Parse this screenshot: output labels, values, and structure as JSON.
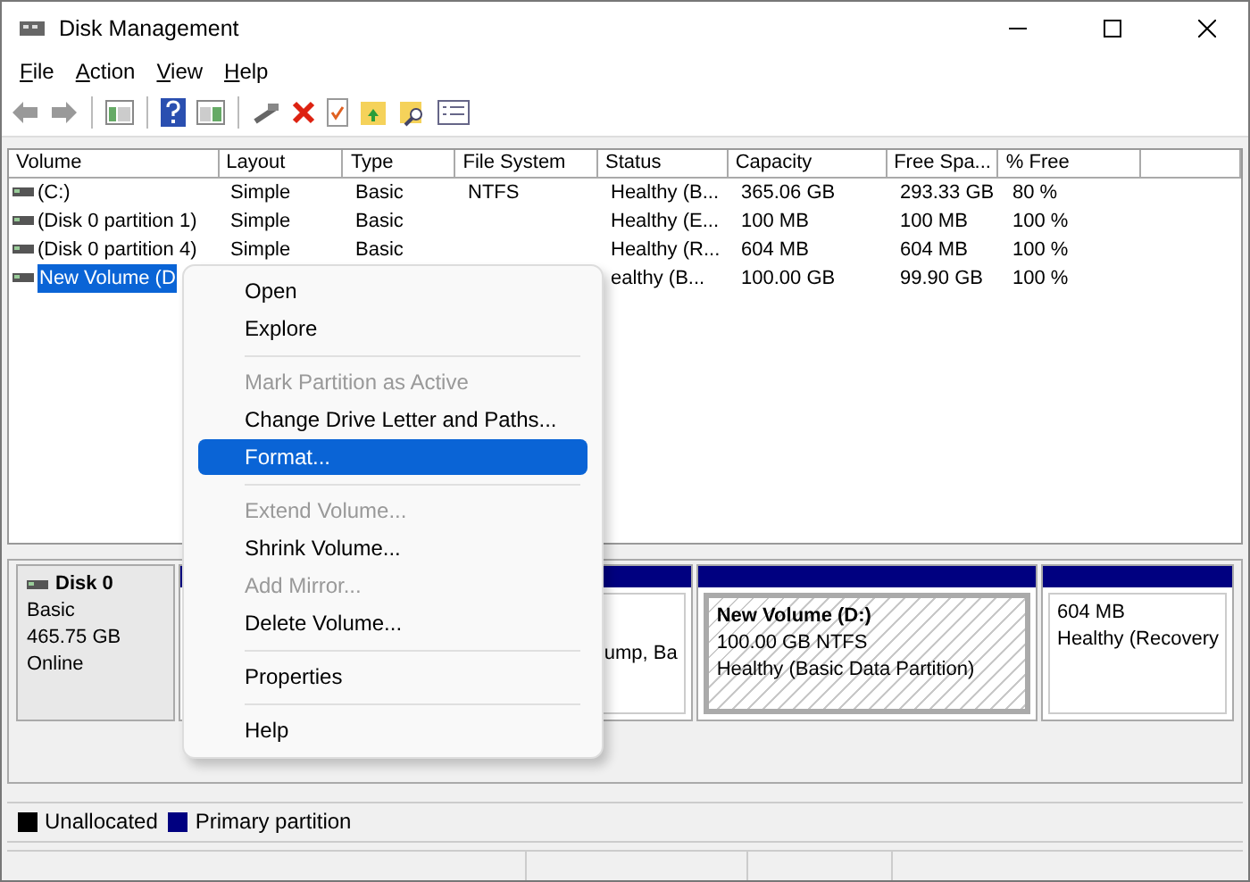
{
  "window": {
    "title": "Disk Management"
  },
  "menu_bar": [
    "File",
    "Action",
    "View",
    "Help"
  ],
  "table": {
    "columns": [
      "Volume",
      "Layout",
      "Type",
      "File System",
      "Status",
      "Capacity",
      "Free Spa...",
      "% Free"
    ],
    "rows": [
      {
        "selected": false,
        "cells": [
          "(C:)",
          "Simple",
          "Basic",
          "NTFS",
          "Healthy (B...",
          "365.06 GB",
          "293.33 GB",
          "80 %"
        ]
      },
      {
        "selected": false,
        "cells": [
          "(Disk 0 partition 1)",
          "Simple",
          "Basic",
          "",
          "Healthy (E...",
          "100 MB",
          "100 MB",
          "100 %"
        ]
      },
      {
        "selected": false,
        "cells": [
          "(Disk 0 partition 4)",
          "Simple",
          "Basic",
          "",
          "Healthy (R...",
          "604 MB",
          "604 MB",
          "100 %"
        ]
      },
      {
        "selected": true,
        "cells": [
          "New Volume (D",
          "",
          "",
          "",
          "ealthy (B...",
          "100.00 GB",
          "99.90 GB",
          "100 %"
        ]
      }
    ]
  },
  "disk": {
    "name": "Disk 0",
    "type": "Basic",
    "size": "465.75 GB",
    "state": "Online",
    "partitions": [
      {
        "lines": [
          "ump, Ba"
        ],
        "selected": false
      },
      {
        "title": "New Volume  (D:)",
        "lines": [
          "100.00 GB NTFS",
          "Healthy (Basic Data Partition)"
        ],
        "selected": true
      },
      {
        "lines": [
          "604 MB",
          "Healthy (Recovery"
        ],
        "selected": false
      }
    ]
  },
  "legend": [
    {
      "label": "Unallocated",
      "color": "#000000"
    },
    {
      "label": "Primary partition",
      "color": "#000080"
    }
  ],
  "context_menu": [
    {
      "kind": "item",
      "label": "Open",
      "disabled": false,
      "selected": false
    },
    {
      "kind": "item",
      "label": "Explore",
      "disabled": false,
      "selected": false
    },
    {
      "kind": "separator"
    },
    {
      "kind": "item",
      "label": "Mark Partition as Active",
      "disabled": true,
      "selected": false
    },
    {
      "kind": "item",
      "label": "Change Drive Letter and Paths...",
      "disabled": false,
      "selected": false
    },
    {
      "kind": "item",
      "label": "Format...",
      "disabled": false,
      "selected": true
    },
    {
      "kind": "separator"
    },
    {
      "kind": "item",
      "label": "Extend Volume...",
      "disabled": true,
      "selected": false
    },
    {
      "kind": "item",
      "label": "Shrink Volume...",
      "disabled": false,
      "selected": false
    },
    {
      "kind": "item",
      "label": "Add Mirror...",
      "disabled": true,
      "selected": false
    },
    {
      "kind": "item",
      "label": "Delete Volume...",
      "disabled": false,
      "selected": false
    },
    {
      "kind": "separator"
    },
    {
      "kind": "item",
      "label": "Properties",
      "disabled": false,
      "selected": false
    },
    {
      "kind": "separator"
    },
    {
      "kind": "item",
      "label": "Help",
      "disabled": false,
      "selected": false
    }
  ]
}
